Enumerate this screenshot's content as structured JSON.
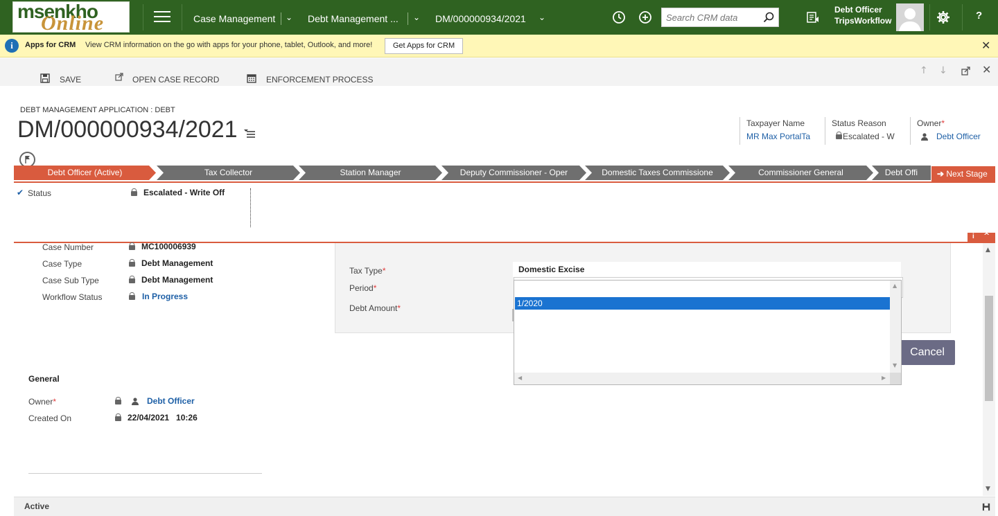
{
  "topbar": {
    "logo_line1": "msenkho",
    "logo_line2": "Online",
    "nav_module": "Case Management",
    "nav_entity": "Debt Management ...",
    "nav_record": "DM/000000934/2021",
    "search_placeholder": "Search CRM data",
    "user_name": "Debt Officer",
    "user_org": "TripsWorkflow",
    "help": "?"
  },
  "notification": {
    "title": "Apps for CRM",
    "message": "View CRM information on the go with apps for your phone, tablet, Outlook, and more!",
    "button": "Get Apps for CRM"
  },
  "commands": {
    "save": "SAVE",
    "open_case": "OPEN CASE RECORD",
    "enforcement": "ENFORCEMENT PROCESS"
  },
  "header": {
    "entity_type": "DEBT MANAGEMENT APPLICATION : DEBT",
    "record_title": "DM/000000934/2021",
    "fields": [
      {
        "label": "Taxpayer Name",
        "value": "MR Max PortalTa"
      },
      {
        "label": "Status Reason",
        "value": "Escalated - W"
      },
      {
        "label": "Owner",
        "value": "Debt Officer"
      }
    ]
  },
  "process": {
    "stages": [
      "Debt Officer (Active)",
      "Tax Collector",
      "Station Manager",
      "Deputy Commissioner - Oper",
      "Domestic Taxes Commissione",
      "Commissioner General",
      "Debt Offi"
    ],
    "next_stage": "Next Stage",
    "status_label": "Status",
    "status_value": "Escalated - Write Off"
  },
  "details": {
    "case_number_label": "Case Number",
    "case_number": "MC100006939",
    "case_type_label": "Case Type",
    "case_type": "Debt Management",
    "case_sub_type_label": "Case Sub Type",
    "case_sub_type": "Debt Management",
    "workflow_status_label": "Workflow Status",
    "workflow_status": "In Progress"
  },
  "panel": {
    "tax_type_label": "Tax Type",
    "tax_type_value": "Domestic Excise",
    "period_label": "Period",
    "debt_amount_label": "Debt Amount",
    "period_options": [
      "1/2020"
    ],
    "cancel": "Cancel"
  },
  "general": {
    "title": "General",
    "owner_label": "Owner",
    "owner": "Debt Officer",
    "created_on_label": "Created On",
    "created_on": "22/04/2021   10:26"
  },
  "footer": {
    "state": "Active"
  },
  "colors": {
    "brand_green": "#2f6221",
    "stage_active": "#d95b3e",
    "stage_inactive": "#6f6f6f",
    "link_blue": "#1d5fa6",
    "selection_blue": "#1a73d1"
  }
}
